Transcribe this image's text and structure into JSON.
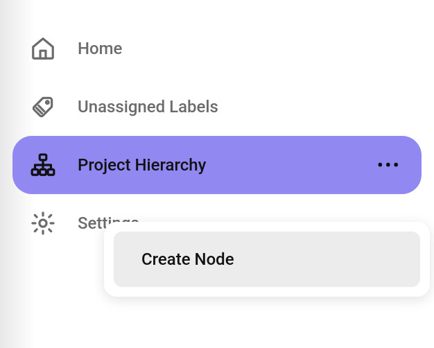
{
  "sidebar": {
    "items": [
      {
        "label": "Home"
      },
      {
        "label": "Unassigned Labels"
      },
      {
        "label": "Project Hierarchy"
      },
      {
        "label": "Settings"
      }
    ]
  },
  "popover": {
    "items": [
      {
        "label": "Create Node"
      }
    ]
  }
}
